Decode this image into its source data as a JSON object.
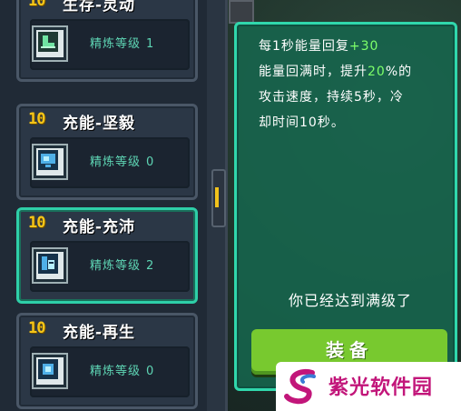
{
  "upgrades": [
    {
      "level": "10",
      "title": "生存-灵动",
      "refine_label": "精炼等级",
      "refine_value": "1",
      "icon": "boot-icon",
      "selected": false
    },
    {
      "level": "10",
      "title": "充能-坚毅",
      "refine_label": "精炼等级",
      "refine_value": "0",
      "icon": "monitor-icon",
      "selected": false
    },
    {
      "level": "10",
      "title": "充能-充沛",
      "refine_label": "精炼等级",
      "refine_value": "2",
      "icon": "chip-icon",
      "selected": true
    },
    {
      "level": "10",
      "title": "充能-再生",
      "refine_label": "精炼等级",
      "refine_value": "0",
      "icon": "leaf-icon",
      "selected": false
    }
  ],
  "detail": {
    "line1_a": "每1秒能量回复",
    "line1_b": "+30",
    "line2_a": "能量回满时，提升",
    "line2_b": "20",
    "line2_c": "%的",
    "line3": "攻击速度，持续5秒，冷",
    "line4": "却时间10秒。",
    "maxed": "你已经达到满级了",
    "equip_label": "装备"
  },
  "watermark": {
    "text": "紫光软件园"
  },
  "colors": {
    "accent": "#30d7ac",
    "level": "#f5c518",
    "highlight": "#7dff6a",
    "button": "#78c92f",
    "watermark": "#c2167a"
  }
}
